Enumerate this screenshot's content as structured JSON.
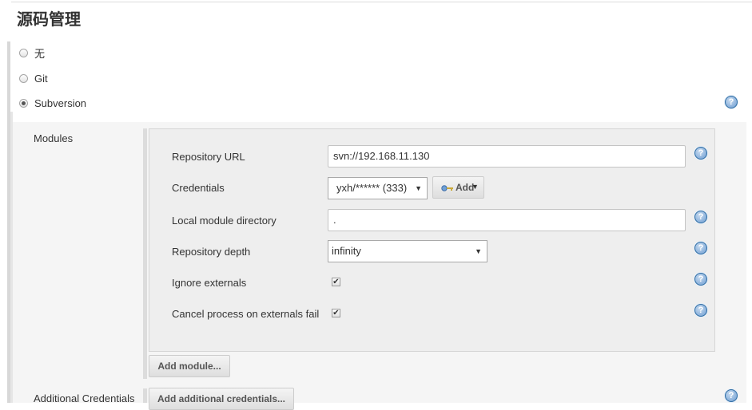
{
  "section": {
    "title": "源码管理"
  },
  "scm_options": [
    {
      "label": "无",
      "selected": false
    },
    {
      "label": "Git",
      "selected": false
    },
    {
      "label": "Subversion",
      "selected": true
    }
  ],
  "modules": {
    "label": "Modules",
    "repository_url": {
      "label": "Repository URL",
      "value": "svn://192.168.11.130"
    },
    "credentials": {
      "label": "Credentials",
      "selected": "yxh/****** (333)",
      "add_label": "Add"
    },
    "local_module_directory": {
      "label": "Local module directory",
      "value": "."
    },
    "repository_depth": {
      "label": "Repository depth",
      "selected": "infinity"
    },
    "ignore_externals": {
      "label": "Ignore externals",
      "checked": true
    },
    "cancel_process": {
      "label": "Cancel process on externals fail",
      "checked": true
    },
    "add_module_label": "Add module..."
  },
  "additional_credentials": {
    "label": "Additional Credentials",
    "button_label": "Add additional credentials..."
  },
  "icons": {
    "help": "help-icon",
    "key": "key-icon",
    "dropdown": "chevron-down-icon"
  },
  "help_glyph": "?",
  "check_glyph": "✔",
  "arrow_glyph": "▼",
  "colors": {
    "help_blue": "#2e6da4",
    "panel_bg": "#f5f5f5",
    "module_bg": "#eeeeee"
  }
}
